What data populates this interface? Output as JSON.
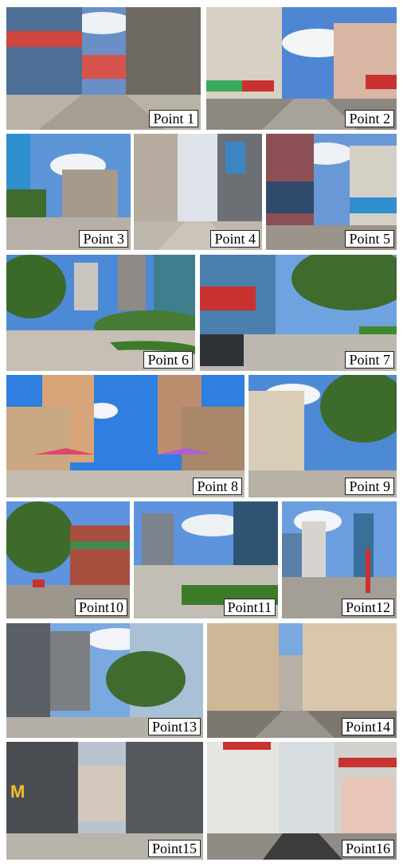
{
  "labels": {
    "p1": "Point 1",
    "p2": "Point 2",
    "p3": "Point 3",
    "p4": "Point 4",
    "p5": "Point 5",
    "p6": "Point 6",
    "p7": "Point 7",
    "p8": "Point 8",
    "p9": "Point 9",
    "p10": "Point10",
    "p11": "Point11",
    "p12": "Point12",
    "p13": "Point13",
    "p14": "Point14",
    "p15": "Point15",
    "p16": "Point16"
  },
  "colors": {
    "sky": "#5b8fd6",
    "cloud": "#f2f4f7",
    "pavement": "#b7b3ac",
    "building_light": "#d9d2c6",
    "building_dark": "#5d5a58",
    "tree": "#3f6b2e",
    "red": "#c8322f",
    "label_bg": "#ffffff"
  }
}
